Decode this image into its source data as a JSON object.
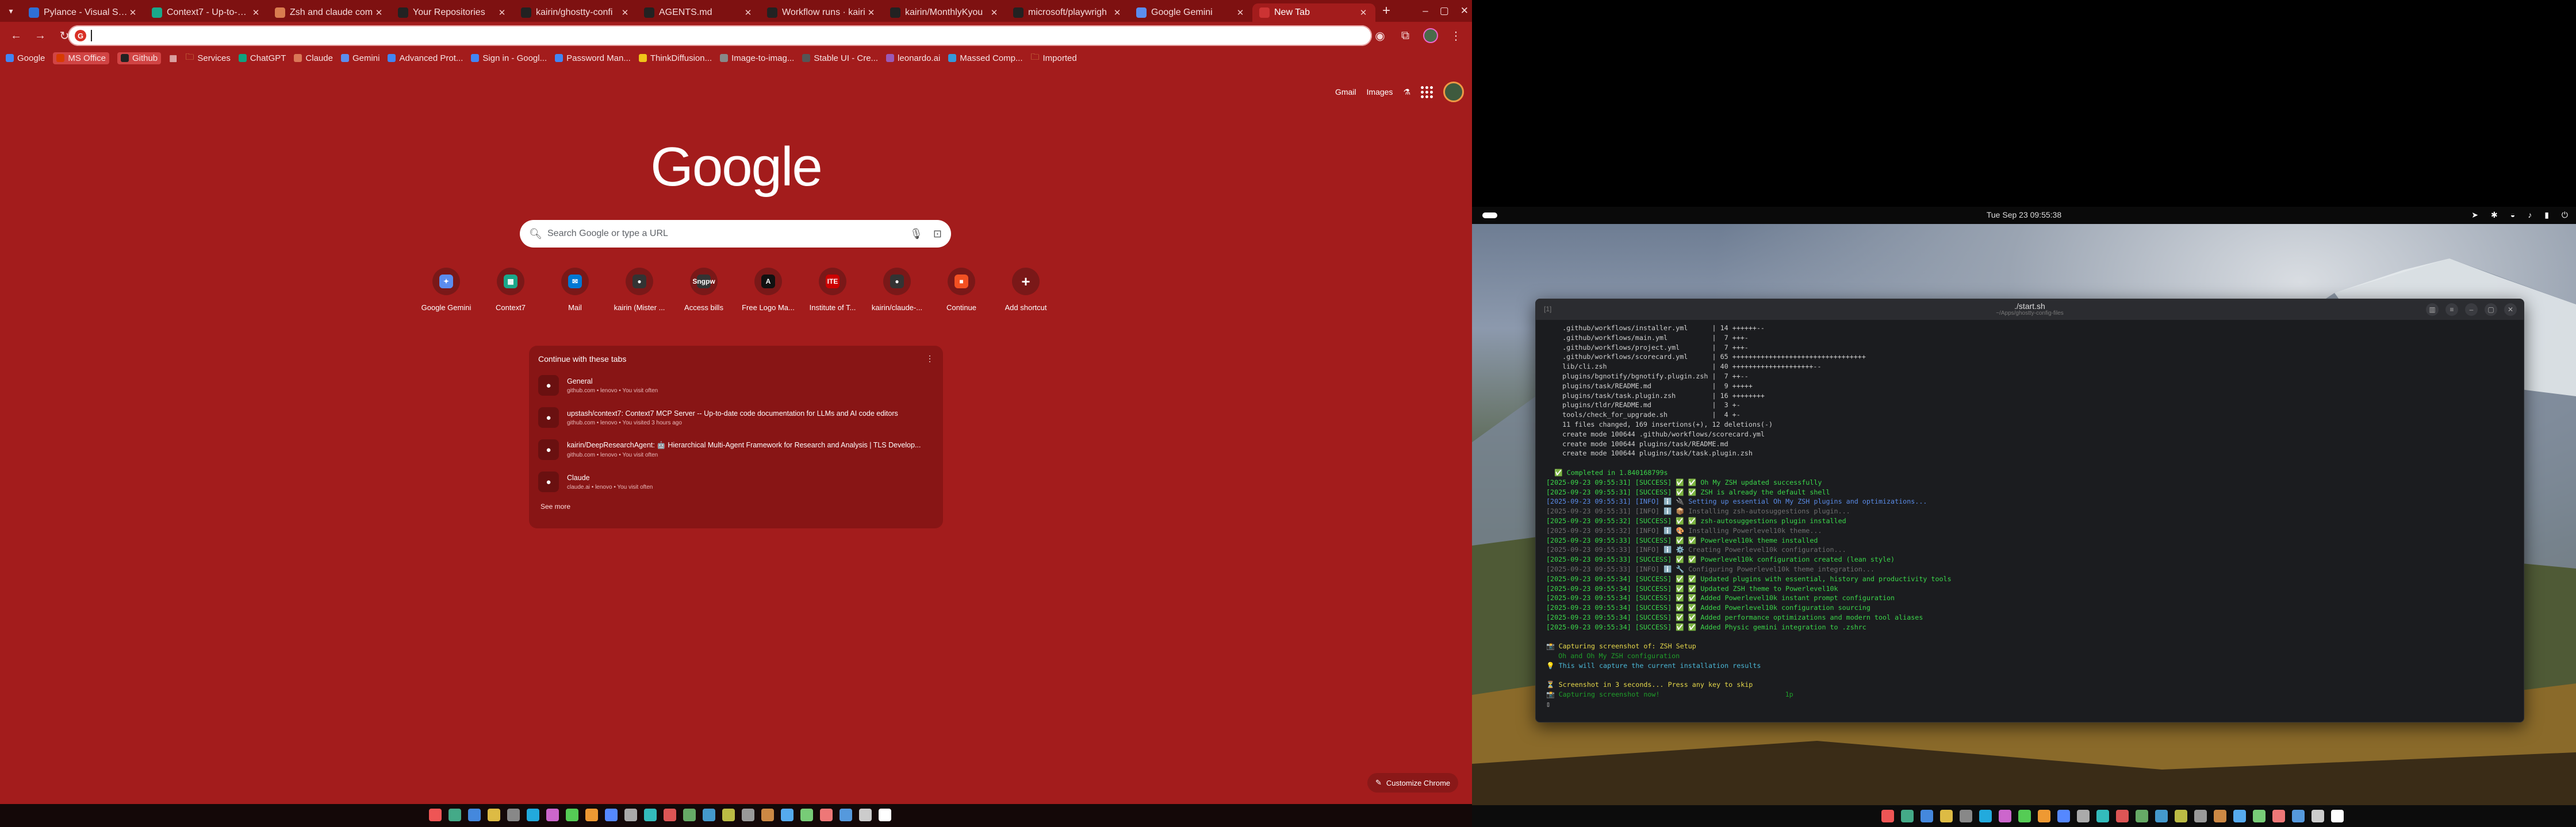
{
  "chrome": {
    "tabs": [
      {
        "title": "Pylance - Visual Stud",
        "fav": "#2f6fd6"
      },
      {
        "title": "Context7 - Up-to-date",
        "fav": "#1aa88a"
      },
      {
        "title": "Zsh and claude com",
        "fav": "#d97c4f"
      },
      {
        "title": "Your Repositories",
        "fav": "#222"
      },
      {
        "title": "kairin/ghostty-confi",
        "fav": "#222"
      },
      {
        "title": "AGENTS.md",
        "fav": "#222"
      },
      {
        "title": "Workflow runs · kairi",
        "fav": "#222"
      },
      {
        "title": "kairin/MonthlyKyou",
        "fav": "#222"
      },
      {
        "title": "microsoft/playwrigh",
        "fav": "#222"
      },
      {
        "title": "Google Gemini",
        "fav": "#5b8def"
      },
      {
        "title": "New Tab",
        "fav": "#c33",
        "active": true
      }
    ],
    "new_tab_symbol": "+",
    "win_minimize": "–",
    "win_maximize": "▢",
    "win_close": "✕",
    "omnibox_value": "",
    "bookmarks": [
      {
        "label": "Google",
        "color": "#4285f4"
      },
      {
        "label": "MS Office",
        "color": "#d83b01",
        "boxed": true
      },
      {
        "label": "Github",
        "color": "#222",
        "boxed": true
      },
      {
        "label": "Services",
        "color": "#e6b35a",
        "folder": true
      },
      {
        "label": "ChatGPT",
        "color": "#10a37f"
      },
      {
        "label": "Claude",
        "color": "#d97757"
      },
      {
        "label": "Gemini",
        "color": "#5b8def"
      },
      {
        "label": "Advanced Prot...",
        "color": "#4285f4"
      },
      {
        "label": "Sign in - Googl...",
        "color": "#4285f4"
      },
      {
        "label": "Password Man...",
        "color": "#4285f4"
      },
      {
        "label": "ThinkDiffusion...",
        "color": "#f0c419"
      },
      {
        "label": "Image-to-imag...",
        "color": "#888"
      },
      {
        "label": "Stable UI - Cre...",
        "color": "#555"
      },
      {
        "label": "leonardo.ai",
        "color": "#9b59b6"
      },
      {
        "label": "Massed Comp...",
        "color": "#3498db"
      },
      {
        "label": "Imported",
        "color": "#e6b35a",
        "folder": true
      }
    ],
    "header_links": {
      "gmail": "Gmail",
      "images": "Images"
    },
    "logo": "Google",
    "search_placeholder": "Search Google or type a URL",
    "shortcuts": [
      {
        "label": "Google Gemini",
        "glyph": "✦",
        "color": "#5b8def"
      },
      {
        "label": "Context7",
        "glyph": "▦",
        "color": "#1aa88a"
      },
      {
        "label": "Mail",
        "glyph": "✉",
        "color": "#0078d4"
      },
      {
        "label": "kairin (Mister ...",
        "glyph": "●",
        "color": "#333"
      },
      {
        "label": "Access bills",
        "glyph": "Sngpw",
        "color": "#333"
      },
      {
        "label": "Free Logo Ma...",
        "glyph": "A",
        "color": "#111"
      },
      {
        "label": "Institute of T...",
        "glyph": "ITE",
        "color": "#c00"
      },
      {
        "label": "kairin/claude-...",
        "glyph": "●",
        "color": "#333"
      },
      {
        "label": "Continue",
        "glyph": "■",
        "color": "#f25022"
      },
      {
        "label": "Add shortcut",
        "glyph": "+",
        "color": "#7a1818"
      }
    ],
    "continue_card": {
      "heading": "Continue with these tabs",
      "menu_symbol": "⋮",
      "items": [
        {
          "title": "General",
          "sub": "github.com • lenovo • You visit often"
        },
        {
          "title": "upstash/context7: Context7 MCP Server -- Up-to-date code documentation for LLMs and AI code editors",
          "sub": "github.com • lenovo • You visited 3 hours ago"
        },
        {
          "title": "kairin/DeepResearchAgent: 🤖 Hierarchical Multi-Agent Framework for Research and Analysis | TLS Develop...",
          "sub": "github.com • lenovo • You visit often"
        },
        {
          "title": "Claude",
          "sub": "claude.ai • lenovo • You visit often"
        }
      ],
      "see_more": "See more"
    },
    "customize_label": "Customize Chrome"
  },
  "desktop": {
    "clock": "Tue Sep 23  09:55:38",
    "terminal": {
      "title": "./start.sh",
      "subtitle": "~/Apps/ghostty-config-files",
      "tab_indicator": "[1]",
      "lines": [
        {
          "t": "    .github/workflows/installer.yml      | 14 ++++++--",
          "c": "c-def"
        },
        {
          "t": "    .github/workflows/main.yml           |  7 +++-",
          "c": "c-def"
        },
        {
          "t": "    .github/workflows/project.yml        |  7 +++-",
          "c": "c-def"
        },
        {
          "t": "    .github/workflows/scorecard.yml      | 65 +++++++++++++++++++++++++++++++++",
          "c": "c-def"
        },
        {
          "t": "    lib/cli.zsh                          | 40 ++++++++++++++++++++--",
          "c": "c-def"
        },
        {
          "t": "    plugins/bgnotify/bgnotify.plugin.zsh |  7 ++--",
          "c": "c-def"
        },
        {
          "t": "    plugins/task/README.md               |  9 +++++",
          "c": "c-def"
        },
        {
          "t": "    plugins/task/task.plugin.zsh         | 16 ++++++++",
          "c": "c-def"
        },
        {
          "t": "    plugins/tldr/README.md               |  3 +-",
          "c": "c-def"
        },
        {
          "t": "    tools/check_for_upgrade.sh           |  4 +-",
          "c": "c-def"
        },
        {
          "t": "    11 files changed, 169 insertions(+), 12 deletions(-)",
          "c": "c-def"
        },
        {
          "t": "    create mode 100644 .github/workflows/scorecard.yml",
          "c": "c-def"
        },
        {
          "t": "    create mode 100644 plugins/task/README.md",
          "c": "c-def"
        },
        {
          "t": "    create mode 100644 plugins/task/task.plugin.zsh",
          "c": "c-def"
        },
        {
          "t": "",
          "c": "c-def"
        },
        {
          "t": "  ✅ Completed in 1.840168799s",
          "c": "c-grn"
        },
        {
          "t": "[2025-09-23 09:55:31] [SUCCESS] ✅ ✅ Oh My ZSH updated successfully",
          "c": "c-grn"
        },
        {
          "t": "[2025-09-23 09:55:31] [SUCCESS] ✅ ✅ ZSH is already the default shell",
          "c": "c-grn"
        },
        {
          "t": "[2025-09-23 09:55:31] [INFO] ℹ️ 🔌 Setting up essential Oh My ZSH plugins and optimizations...",
          "c": "c-blu"
        },
        {
          "t": "[2025-09-23 09:55:31] [INFO] ℹ️ 📦 Installing zsh-autosuggestions plugin...",
          "c": "c-dim"
        },
        {
          "t": "[2025-09-23 09:55:32] [SUCCESS] ✅ ✅ zsh-autosuggestions plugin installed",
          "c": "c-grn"
        },
        {
          "t": "[2025-09-23 09:55:32] [INFO] ℹ️ 🎨 Installing Powerlevel10k theme...",
          "c": "c-dim"
        },
        {
          "t": "[2025-09-23 09:55:33] [SUCCESS] ✅ ✅ Powerlevel10k theme installed",
          "c": "c-grn"
        },
        {
          "t": "[2025-09-23 09:55:33] [INFO] ℹ️ ⚙️ Creating Powerlevel10k configuration...",
          "c": "c-dim"
        },
        {
          "t": "[2025-09-23 09:55:33] [SUCCESS] ✅ ✅ Powerlevel10k configuration created (lean style)",
          "c": "c-grn"
        },
        {
          "t": "[2025-09-23 09:55:33] [INFO] ℹ️ 🔧 Configuring Powerlevel10k theme integration...",
          "c": "c-dim"
        },
        {
          "t": "[2025-09-23 09:55:34] [SUCCESS] ✅ ✅ Updated plugins with essential, history and productivity tools",
          "c": "c-grn"
        },
        {
          "t": "[2025-09-23 09:55:34] [SUCCESS] ✅ ✅ Updated ZSH theme to Powerlevel10k",
          "c": "c-grn"
        },
        {
          "t": "[2025-09-23 09:55:34] [SUCCESS] ✅ ✅ Added Powerlevel10k instant prompt configuration",
          "c": "c-grn"
        },
        {
          "t": "[2025-09-23 09:55:34] [SUCCESS] ✅ ✅ Added Powerlevel10k configuration sourcing",
          "c": "c-grn"
        },
        {
          "t": "[2025-09-23 09:55:34] [SUCCESS] ✅ ✅ Added performance optimizations and modern tool aliases",
          "c": "c-grn"
        },
        {
          "t": "[2025-09-23 09:55:34] [SUCCESS] ✅ ✅ Added Physic gemini integration to .zshrc",
          "c": "c-grn"
        },
        {
          "t": "",
          "c": "c-def"
        },
        {
          "t": "📸 Capturing screenshot of: ZSH Setup",
          "c": "c-ylw"
        },
        {
          "t": "   Oh and Oh My ZSH configuration",
          "c": "c-dgrn"
        },
        {
          "t": "💡 This will capture the current installation results",
          "c": "c-cyan"
        },
        {
          "t": "",
          "c": "c-def"
        },
        {
          "t": "⏳ Screenshot in 3 seconds... Press any key to skip",
          "c": "c-ylw"
        },
        {
          "t": "📸 Capturing screenshot now!                               1p",
          "c": "c-dgrn"
        },
        {
          "t": "▯",
          "c": "c-def"
        }
      ]
    }
  },
  "colors": {
    "chrome_bg": "#a31c1c",
    "tabstrip": "#7e1111",
    "card": "#881515",
    "terminal_bg": "#1b1c1f",
    "success_green": "#3bd64a"
  }
}
